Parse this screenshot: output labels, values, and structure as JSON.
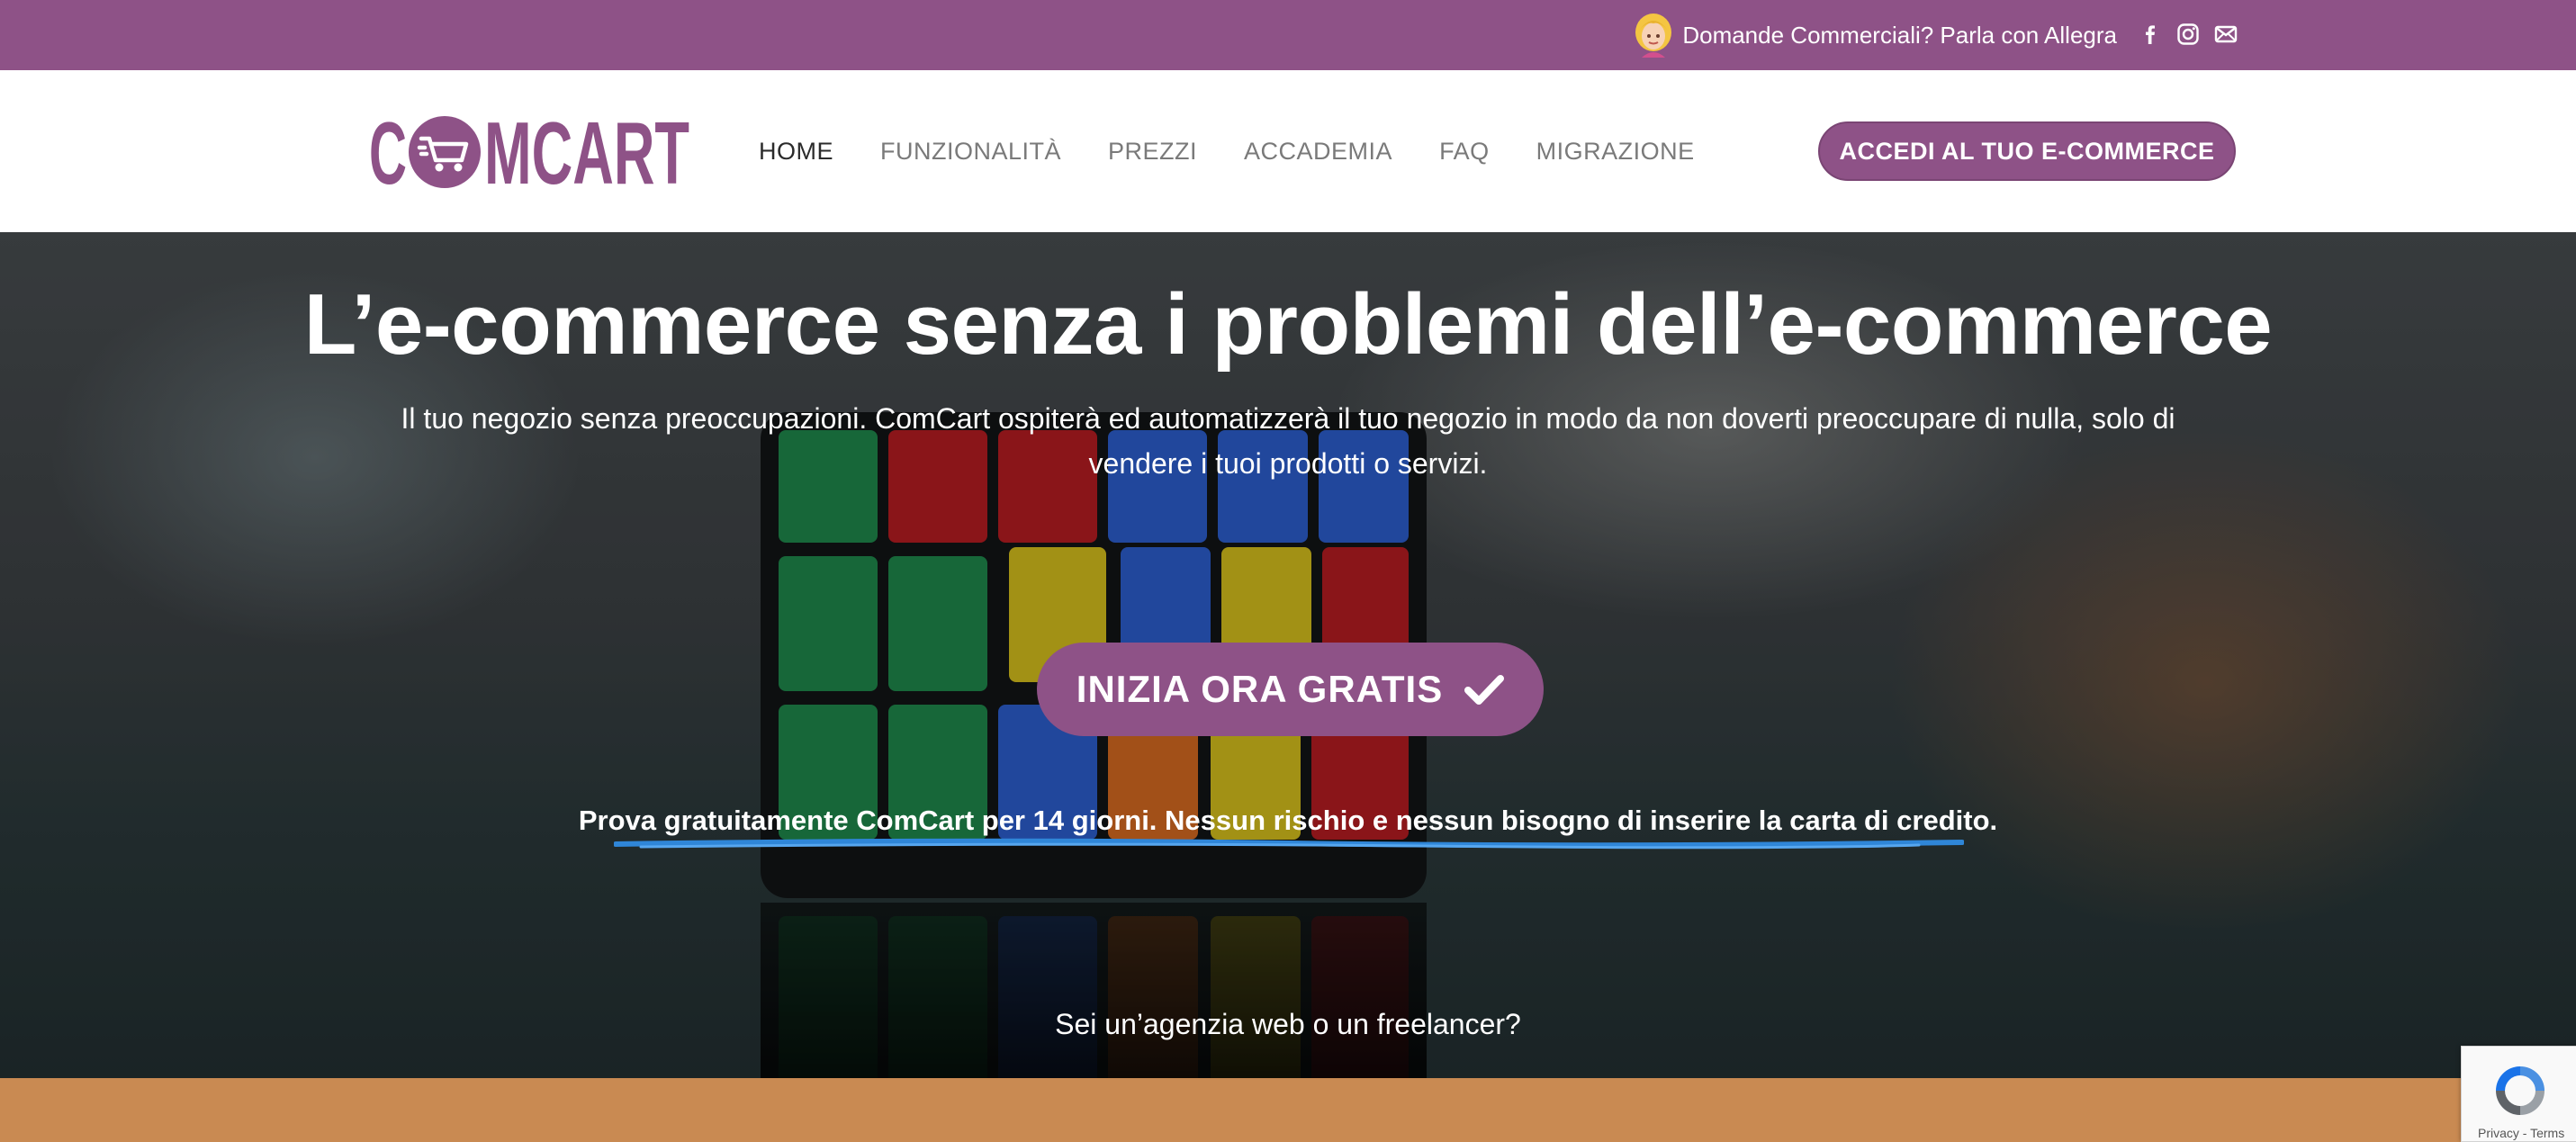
{
  "topbar": {
    "contact_text": "Domande Commerciali? Parla con Allegra",
    "social_icons": [
      "facebook-icon",
      "instagram-icon",
      "mail-icon"
    ],
    "background": "#8e5287"
  },
  "header": {
    "brand": "COMCART",
    "nav": [
      {
        "label": "HOME",
        "active": true
      },
      {
        "label": "FUNZIONALITÀ",
        "active": false
      },
      {
        "label": "PREZZI",
        "active": false
      },
      {
        "label": "ACCADEMIA",
        "active": false
      },
      {
        "label": "FAQ",
        "active": false
      },
      {
        "label": "MIGRAZIONE",
        "active": false
      }
    ],
    "login_label": "ACCEDI AL TUO E-COMMERCE",
    "accent": "#8e5287"
  },
  "hero": {
    "title": "L’e-commerce senza i problemi dell’e-commerce",
    "subtitle": "Il tuo negozio senza preoccupazioni. ComCart ospiterà ed automatizzerà il tuo negozio in modo da non doverti preoccupare di nulla, solo di vendere i tuoi prodotti o servizi.",
    "cta_label": "INIZIA ORA GRATIS",
    "trial_text": "Prova gratuitamente ComCart per 14 giorni. Nessun rischio e nessun bisogno di inserire la carta di credito.",
    "agency_link": "Sei un’agenzia web o un freelancer?"
  },
  "recaptcha": {
    "text": "Privacy - Terms"
  },
  "colors": {
    "purple": "#8e5287",
    "orange_band": "#c98a52",
    "underline_blue": "#2f86d8"
  }
}
